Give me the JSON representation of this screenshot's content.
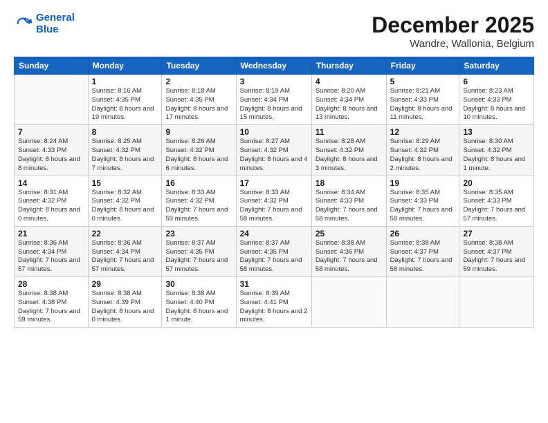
{
  "logo": {
    "line1": "General",
    "line2": "Blue"
  },
  "header": {
    "month": "December 2025",
    "location": "Wandre, Wallonia, Belgium"
  },
  "weekdays": [
    "Sunday",
    "Monday",
    "Tuesday",
    "Wednesday",
    "Thursday",
    "Friday",
    "Saturday"
  ],
  "weeks": [
    [
      {
        "day": "",
        "sunrise": "",
        "sunset": "",
        "daylight": ""
      },
      {
        "day": "1",
        "sunrise": "Sunrise: 8:16 AM",
        "sunset": "Sunset: 4:35 PM",
        "daylight": "Daylight: 8 hours and 19 minutes."
      },
      {
        "day": "2",
        "sunrise": "Sunrise: 8:18 AM",
        "sunset": "Sunset: 4:35 PM",
        "daylight": "Daylight: 8 hours and 17 minutes."
      },
      {
        "day": "3",
        "sunrise": "Sunrise: 8:19 AM",
        "sunset": "Sunset: 4:34 PM",
        "daylight": "Daylight: 8 hours and 15 minutes."
      },
      {
        "day": "4",
        "sunrise": "Sunrise: 8:20 AM",
        "sunset": "Sunset: 4:34 PM",
        "daylight": "Daylight: 8 hours and 13 minutes."
      },
      {
        "day": "5",
        "sunrise": "Sunrise: 8:21 AM",
        "sunset": "Sunset: 4:33 PM",
        "daylight": "Daylight: 8 hours and 11 minutes."
      },
      {
        "day": "6",
        "sunrise": "Sunrise: 8:23 AM",
        "sunset": "Sunset: 4:33 PM",
        "daylight": "Daylight: 8 hours and 10 minutes."
      }
    ],
    [
      {
        "day": "7",
        "sunrise": "Sunrise: 8:24 AM",
        "sunset": "Sunset: 4:33 PM",
        "daylight": "Daylight: 8 hours and 8 minutes."
      },
      {
        "day": "8",
        "sunrise": "Sunrise: 8:25 AM",
        "sunset": "Sunset: 4:32 PM",
        "daylight": "Daylight: 8 hours and 7 minutes."
      },
      {
        "day": "9",
        "sunrise": "Sunrise: 8:26 AM",
        "sunset": "Sunset: 4:32 PM",
        "daylight": "Daylight: 8 hours and 6 minutes."
      },
      {
        "day": "10",
        "sunrise": "Sunrise: 8:27 AM",
        "sunset": "Sunset: 4:32 PM",
        "daylight": "Daylight: 8 hours and 4 minutes."
      },
      {
        "day": "11",
        "sunrise": "Sunrise: 8:28 AM",
        "sunset": "Sunset: 4:32 PM",
        "daylight": "Daylight: 8 hours and 3 minutes."
      },
      {
        "day": "12",
        "sunrise": "Sunrise: 8:29 AM",
        "sunset": "Sunset: 4:32 PM",
        "daylight": "Daylight: 8 hours and 2 minutes."
      },
      {
        "day": "13",
        "sunrise": "Sunrise: 8:30 AM",
        "sunset": "Sunset: 4:32 PM",
        "daylight": "Daylight: 8 hours and 1 minute."
      }
    ],
    [
      {
        "day": "14",
        "sunrise": "Sunrise: 8:31 AM",
        "sunset": "Sunset: 4:32 PM",
        "daylight": "Daylight: 8 hours and 0 minutes."
      },
      {
        "day": "15",
        "sunrise": "Sunrise: 8:32 AM",
        "sunset": "Sunset: 4:32 PM",
        "daylight": "Daylight: 8 hours and 0 minutes."
      },
      {
        "day": "16",
        "sunrise": "Sunrise: 8:33 AM",
        "sunset": "Sunset: 4:32 PM",
        "daylight": "Daylight: 7 hours and 59 minutes."
      },
      {
        "day": "17",
        "sunrise": "Sunrise: 8:33 AM",
        "sunset": "Sunset: 4:32 PM",
        "daylight": "Daylight: 7 hours and 58 minutes."
      },
      {
        "day": "18",
        "sunrise": "Sunrise: 8:34 AM",
        "sunset": "Sunset: 4:33 PM",
        "daylight": "Daylight: 7 hours and 58 minutes."
      },
      {
        "day": "19",
        "sunrise": "Sunrise: 8:35 AM",
        "sunset": "Sunset: 4:33 PM",
        "daylight": "Daylight: 7 hours and 58 minutes."
      },
      {
        "day": "20",
        "sunrise": "Sunrise: 8:35 AM",
        "sunset": "Sunset: 4:33 PM",
        "daylight": "Daylight: 7 hours and 57 minutes."
      }
    ],
    [
      {
        "day": "21",
        "sunrise": "Sunrise: 8:36 AM",
        "sunset": "Sunset: 4:34 PM",
        "daylight": "Daylight: 7 hours and 57 minutes."
      },
      {
        "day": "22",
        "sunrise": "Sunrise: 8:36 AM",
        "sunset": "Sunset: 4:34 PM",
        "daylight": "Daylight: 7 hours and 57 minutes."
      },
      {
        "day": "23",
        "sunrise": "Sunrise: 8:37 AM",
        "sunset": "Sunset: 4:35 PM",
        "daylight": "Daylight: 7 hours and 57 minutes."
      },
      {
        "day": "24",
        "sunrise": "Sunrise: 8:37 AM",
        "sunset": "Sunset: 4:35 PM",
        "daylight": "Daylight: 7 hours and 58 minutes."
      },
      {
        "day": "25",
        "sunrise": "Sunrise: 8:38 AM",
        "sunset": "Sunset: 4:36 PM",
        "daylight": "Daylight: 7 hours and 58 minutes."
      },
      {
        "day": "26",
        "sunrise": "Sunrise: 8:38 AM",
        "sunset": "Sunset: 4:37 PM",
        "daylight": "Daylight: 7 hours and 58 minutes."
      },
      {
        "day": "27",
        "sunrise": "Sunrise: 8:38 AM",
        "sunset": "Sunset: 4:37 PM",
        "daylight": "Daylight: 7 hours and 59 minutes."
      }
    ],
    [
      {
        "day": "28",
        "sunrise": "Sunrise: 8:38 AM",
        "sunset": "Sunset: 4:38 PM",
        "daylight": "Daylight: 7 hours and 59 minutes."
      },
      {
        "day": "29",
        "sunrise": "Sunrise: 8:38 AM",
        "sunset": "Sunset: 4:39 PM",
        "daylight": "Daylight: 8 hours and 0 minutes."
      },
      {
        "day": "30",
        "sunrise": "Sunrise: 8:38 AM",
        "sunset": "Sunset: 4:40 PM",
        "daylight": "Daylight: 8 hours and 1 minute."
      },
      {
        "day": "31",
        "sunrise": "Sunrise: 8:39 AM",
        "sunset": "Sunset: 4:41 PM",
        "daylight": "Daylight: 8 hours and 2 minutes."
      },
      {
        "day": "",
        "sunrise": "",
        "sunset": "",
        "daylight": ""
      },
      {
        "day": "",
        "sunrise": "",
        "sunset": "",
        "daylight": ""
      },
      {
        "day": "",
        "sunrise": "",
        "sunset": "",
        "daylight": ""
      }
    ]
  ]
}
